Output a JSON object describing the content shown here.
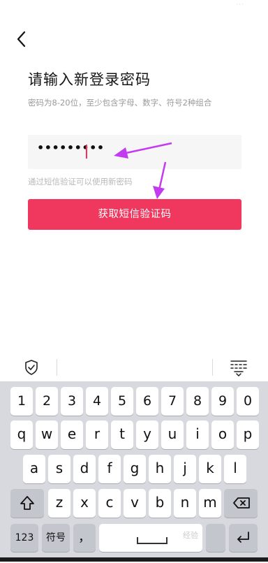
{
  "status_bar": {
    "indicator": "···"
  },
  "header": {
    "back_icon": "chevron-left-icon"
  },
  "page": {
    "title": "请输入新登录密码",
    "hint": "密码为8-20位，至少包含字母、数字、符号2种组合"
  },
  "password_field": {
    "value": "•••••••••"
  },
  "sms_hint": "通过短信验证可以使用新密码",
  "primary_button": {
    "label": "获取短信验证码"
  },
  "colors": {
    "accent": "#f0375d",
    "caret": "#ff2b5c",
    "annotation_arrow": "#c23bf0"
  },
  "keyboard": {
    "toolbar": {
      "left_icon": "shield-check-icon",
      "right_icon": "keyboard-hide-icon"
    },
    "numbers": [
      "1",
      "2",
      "3",
      "4",
      "5",
      "6",
      "7",
      "8",
      "9",
      "0"
    ],
    "row1": [
      "q",
      "w",
      "e",
      "r",
      "t",
      "y",
      "u",
      "i",
      "o",
      "p"
    ],
    "row2": [
      "a",
      "s",
      "d",
      "f",
      "g",
      "h",
      "j",
      "k",
      "l"
    ],
    "row3": [
      "z",
      "x",
      "c",
      "v",
      "b",
      "n",
      "m"
    ],
    "shift_icon": "shift-up-icon",
    "backspace_icon": "backspace-icon",
    "mode_key": "123",
    "symbol_key": "符号",
    "comma_key": "，",
    "enter_icon": "enter-icon"
  },
  "watermark": "经验"
}
